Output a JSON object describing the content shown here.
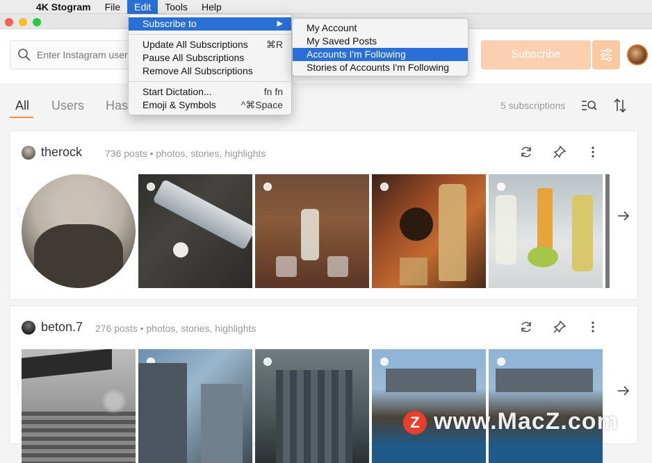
{
  "menubar": {
    "app_name": "4K Stogram",
    "items": [
      "File",
      "Edit",
      "Tools",
      "Help"
    ]
  },
  "toolbar": {
    "search_placeholder": "Enter Instagram username",
    "subscribe_label": "Subscribe",
    "accent": "#fbd0b0"
  },
  "tabs": {
    "all": "All",
    "users": "Users",
    "hashtags": "Has",
    "subscription_count": "5 subscriptions"
  },
  "cards": [
    {
      "name": "therock",
      "meta": "736 posts • photos, stories, highlights"
    },
    {
      "name": "beton.7",
      "meta": "276 posts • photos, stories, highlights"
    }
  ],
  "edit_menu": {
    "subscribe_to": "Subscribe to",
    "update_all": "Update All Subscriptions",
    "update_all_shortcut": "⌘R",
    "pause_all": "Pause All Subscriptions",
    "remove_all": "Remove All Subscriptions",
    "start_dictation": "Start Dictation...",
    "start_dictation_shortcut": "fn fn",
    "emoji": "Emoji & Symbols",
    "emoji_shortcut": "^⌘Space"
  },
  "submenu": {
    "my_account": "My Account",
    "saved_posts": "My Saved Posts",
    "following": "Accounts I'm Following",
    "stories": "Stories of Accounts I'm Following"
  },
  "watermark": {
    "logo": "Z",
    "text": "www.MacZ.com"
  }
}
